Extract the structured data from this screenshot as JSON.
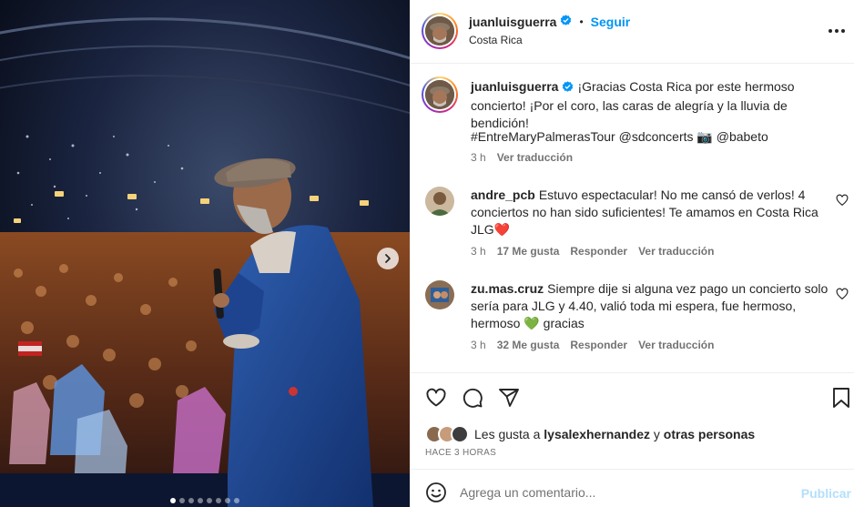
{
  "post": {
    "username": "juanluisguerra",
    "follow_label": "Seguir",
    "location": "Costa Rica",
    "separator": "•",
    "more_icon": "more-horizontal-icon",
    "verified_icon": "verified-badge-icon",
    "carousel": {
      "total_slides": 8,
      "active_slide": 1,
      "next_icon": "chevron-right-icon"
    }
  },
  "caption": {
    "username": "juanluisguerra",
    "text": "¡Gracias Costa Rica por este hermoso concierto! ¡Por el coro, las caras de alegría y la lluvia de bendición!",
    "tags": "#EntreMaryPalmerasTour @sdconcerts 📷 @babeto",
    "time": "3 h",
    "translate_label": "Ver traducción"
  },
  "comments": [
    {
      "username": "andre_pcb",
      "text": "Estuvo espectacular! No me cansó de verlos! 4 conciertos no han sido suficientes! Te amamos en Costa Rica JLG❤️",
      "time": "3 h",
      "likes": "17 Me gusta",
      "reply_label": "Responder",
      "translate_label": "Ver traducción"
    },
    {
      "username": "zu.mas.cruz",
      "text": "Siempre dije si alguna vez pago un concierto solo sería para JLG y 4.40, valió toda mi espera, fue hermoso, hermoso 💚 gracias",
      "time": "3 h",
      "likes": "32 Me gusta",
      "reply_label": "Responder",
      "translate_label": "Ver traducción"
    }
  ],
  "actions": {
    "icons": [
      "heart-icon",
      "comment-icon",
      "share-icon",
      "bookmark-icon"
    ],
    "likes_prefix": "Les gusta a",
    "likes_user": "lysalexhernandez",
    "likes_and": "y",
    "likes_others": "otras personas",
    "time_ago": "HACE 3 HORAS"
  },
  "add_comment": {
    "placeholder": "Agrega un comentario...",
    "publish_label": "Publicar",
    "emoji_icon": "emoji-icon"
  },
  "colors": {
    "accent": "#0095f6",
    "link": "#00376b",
    "secondary_text": "#737373",
    "publish_disabled": "#b2dffc"
  }
}
